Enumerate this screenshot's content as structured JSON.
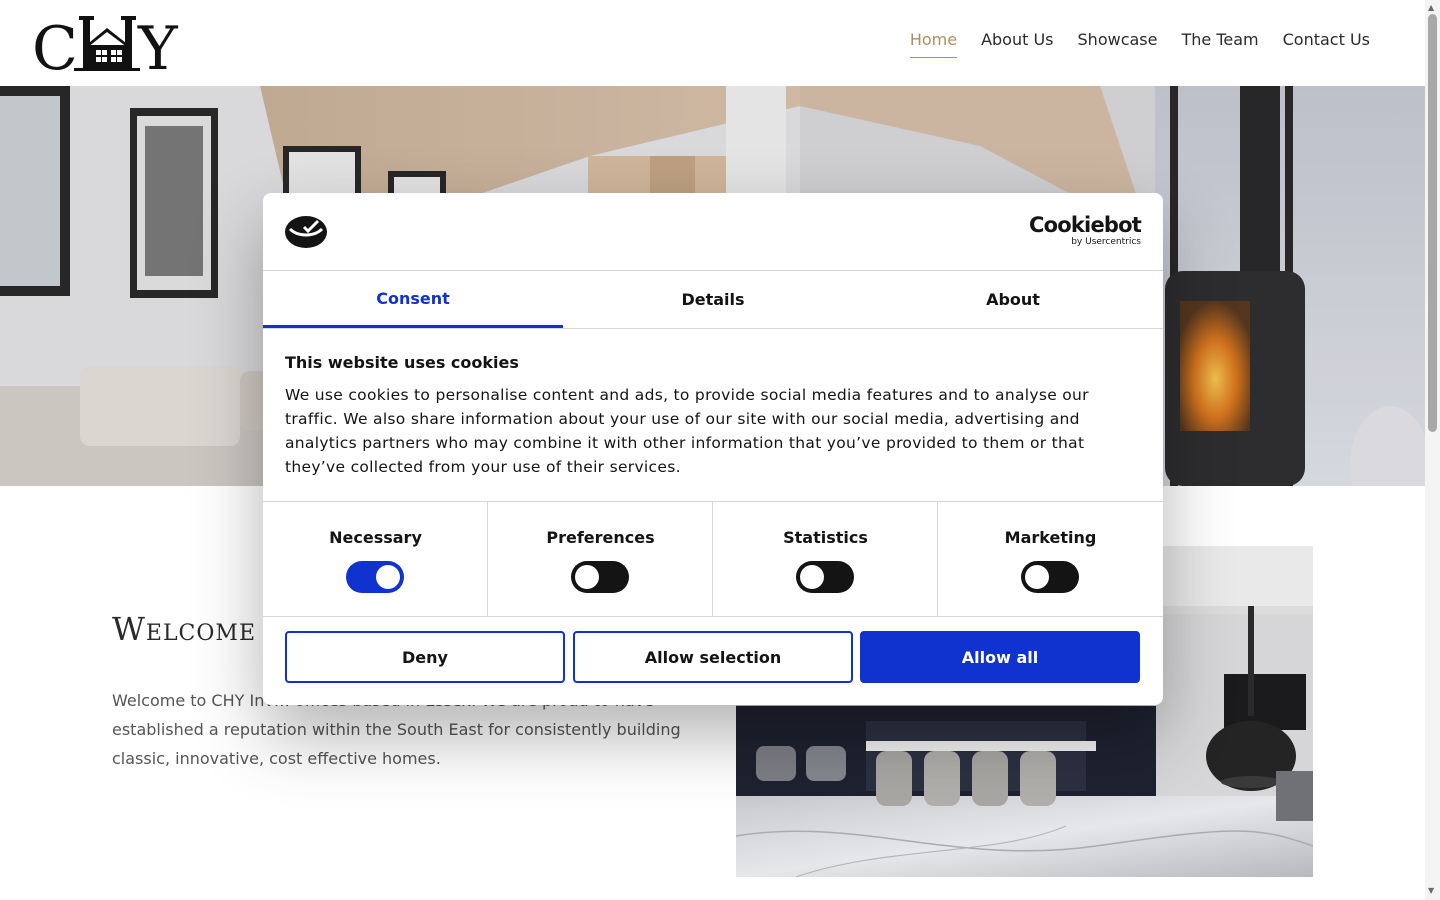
{
  "header": {
    "logo_text": "CHY",
    "nav": [
      {
        "label": "Home",
        "active": true
      },
      {
        "label": "About Us",
        "active": false
      },
      {
        "label": "Showcase",
        "active": false
      },
      {
        "label": "The Team",
        "active": false
      },
      {
        "label": "Contact Us",
        "active": false
      }
    ]
  },
  "welcome": {
    "title": "Welcome",
    "text": "Welcome to CHY Inv… offices based in Essex. We are proud to have established a reputation within the South East for consistently building classic, innovative, cost effective homes."
  },
  "cookie_dialog": {
    "brand": "Cookiebot",
    "brand_sub": "by Usercentrics",
    "tabs": [
      {
        "label": "Consent",
        "active": true
      },
      {
        "label": "Details",
        "active": false
      },
      {
        "label": "About",
        "active": false
      }
    ],
    "heading": "This website uses cookies",
    "body": "We use cookies to personalise content and ads, to provide social media features and to analyse our traffic. We also share information about your use of our site with our social media, advertising and analytics partners who may combine it with other information that you’ve provided to them or that they’ve collected from your use of their services.",
    "categories": [
      {
        "label": "Necessary",
        "enabled": true
      },
      {
        "label": "Preferences",
        "enabled": false
      },
      {
        "label": "Statistics",
        "enabled": false
      },
      {
        "label": "Marketing",
        "enabled": false
      }
    ],
    "buttons": {
      "deny": "Deny",
      "allow_selection": "Allow selection",
      "allow_all": "Allow all"
    }
  },
  "colors": {
    "accent": "#b08d66",
    "cookie_blue": "#1032cf",
    "toggle_off": "#141414"
  },
  "icons": [
    "house-logo-icon",
    "cookiebot-logo-icon",
    "scroll-up-arrow-icon",
    "scroll-down-arrow-icon"
  ]
}
